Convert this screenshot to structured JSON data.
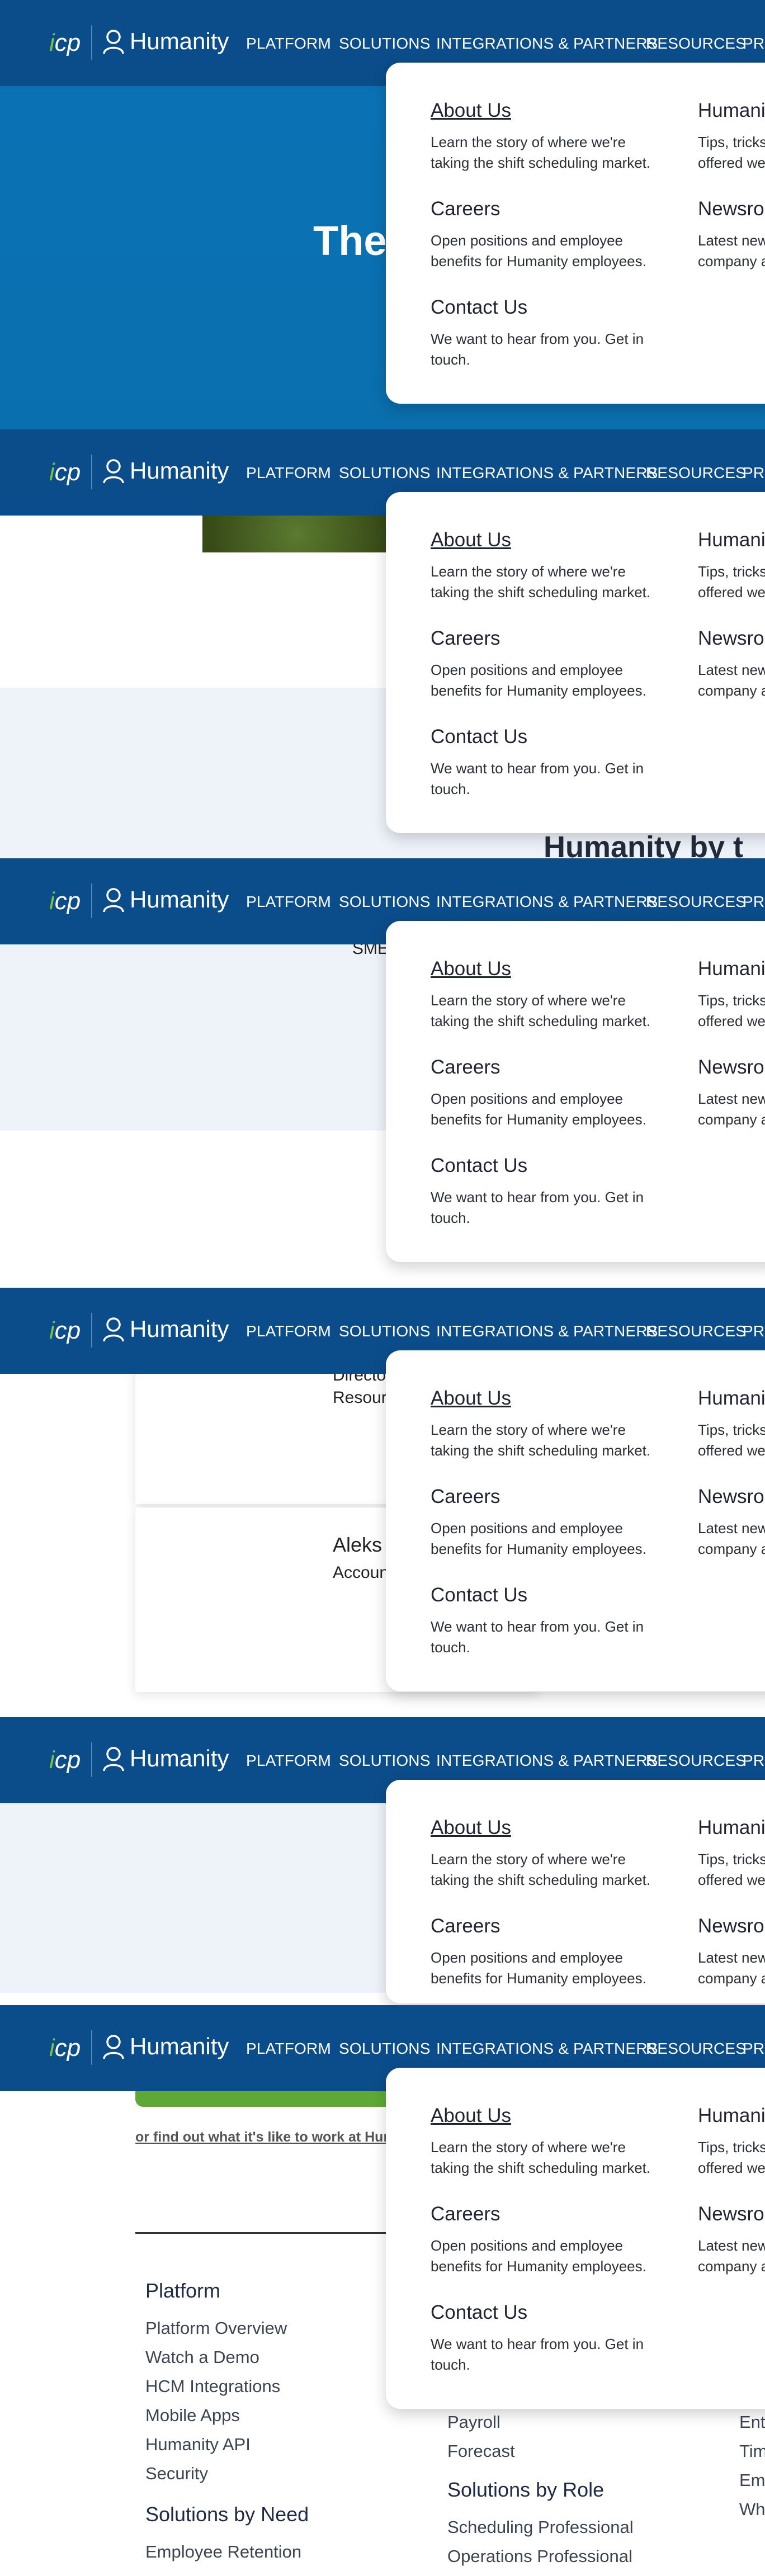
{
  "header": {
    "logo_icp": "icp",
    "logo_text": "Humanity",
    "nav": [
      "PLATFORM",
      "SOLUTIONS",
      "INTEGRATIONS & PARTNERS",
      "RESOURCES",
      "PR"
    ]
  },
  "dropdown": {
    "items": [
      {
        "title": "About Us",
        "desc": "Learn the story of where we're taking the shift scheduling market."
      },
      {
        "title": "Careers",
        "desc": "Open positions and employee benefits for Humanity employees."
      },
      {
        "title": "Contact Us",
        "desc": "We want to hear from you. Get in touch."
      }
    ],
    "right_items": [
      {
        "title": "Humani",
        "desc": "Tips, tricks offered we"
      },
      {
        "title": "Newsro",
        "desc": "Latest new company a"
      }
    ]
  },
  "hero": {
    "title": "The"
  },
  "sections": {
    "heading": "Humanity by t",
    "sme": "SME"
  },
  "cards": [
    {
      "name": "",
      "role": "Directo Resour"
    },
    {
      "name": "Aleks",
      "role": "Accoun"
    }
  ],
  "cta": {
    "work_link": "or find out what it's like to work at Hum"
  },
  "footer": {
    "platform_heading": "Platform",
    "platform_links": [
      "Platform Overview",
      "Watch a Demo",
      "HCM Integrations",
      "Mobile Apps",
      "Humanity API",
      "Security"
    ],
    "need_heading": "Solutions by Need",
    "need_links": [
      "Employee Retention"
    ],
    "middle_links": [
      "Payroll",
      "Forecast"
    ],
    "role_heading": "Solutions by Role",
    "role_links": [
      "Scheduling Professional",
      "Operations Professional"
    ],
    "right_links": [
      "Ent",
      "Tim",
      "Em",
      "Wh"
    ]
  },
  "colors": {
    "header_bg": "#0b4c8a",
    "hero_bg": "#0a73b6",
    "accent_green": "#7bc144",
    "cta_green": "#5ea935",
    "light_band": "#eef3fa"
  }
}
